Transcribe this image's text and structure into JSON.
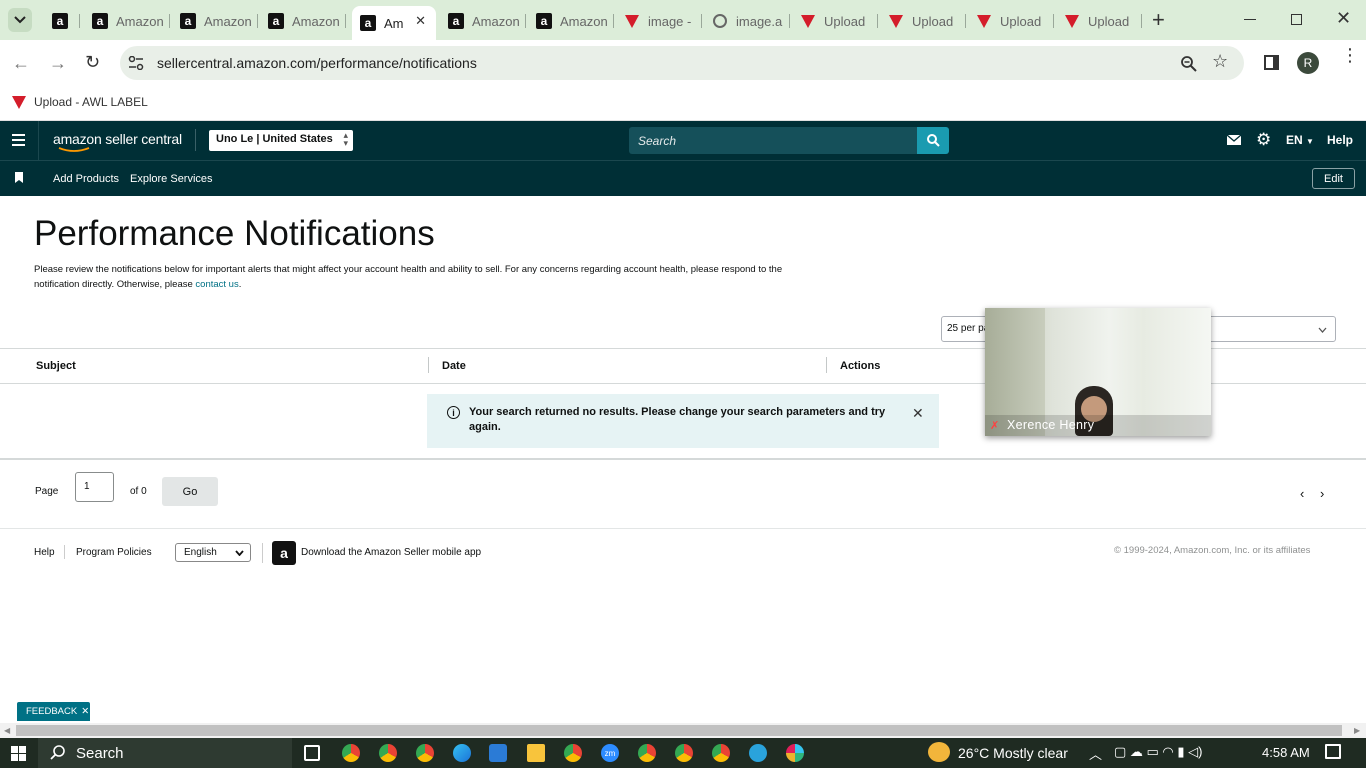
{
  "browser": {
    "tabs": [
      {
        "label": "",
        "icon": "amazon-icon"
      },
      {
        "label": "Amazon",
        "icon": "amazon-icon"
      },
      {
        "label": "Amazon",
        "icon": "amazon-icon"
      },
      {
        "label": "Amazon",
        "icon": "amazon-icon"
      },
      {
        "label": "Am",
        "icon": "amazon-icon",
        "active": true
      },
      {
        "label": "Amazon",
        "icon": "amazon-icon"
      },
      {
        "label": "Amazon",
        "icon": "amazon-icon"
      },
      {
        "label": "image -",
        "icon": "awl-icon"
      },
      {
        "label": "image.a",
        "icon": "openai-icon"
      },
      {
        "label": "Upload",
        "icon": "awl-icon"
      },
      {
        "label": "Upload",
        "icon": "awl-icon"
      },
      {
        "label": "Upload",
        "icon": "awl-icon"
      },
      {
        "label": "Upload",
        "icon": "awl-icon"
      }
    ],
    "url": "sellercentral.amazon.com/performance/notifications",
    "profile_initial": "R",
    "bookmark": "Upload - AWL LABEL"
  },
  "seller": {
    "logo": "amazon seller central",
    "account": "Uno Le | United States",
    "search_placeholder": "Search",
    "lang": "EN",
    "help": "Help",
    "nav": [
      "Add Products",
      "Explore Services"
    ],
    "edit": "Edit"
  },
  "page": {
    "title": "Performance Notifications",
    "desc": "Please review the notifications below for important alerts that might affect your account health and ability to sell. For any concerns regarding account health, please respond to the",
    "desc2": "notification directly. Otherwise, please ",
    "contact": "contact us",
    "desc_end": ".",
    "per_page": "25 per pa",
    "columns": [
      "Subject",
      "Date",
      "Actions"
    ],
    "alert": "Your search returned no results. Please change your search parameters and try",
    "alert2": "again.",
    "page_label": "Page",
    "page_value": "1",
    "of": "of 0",
    "go": "Go"
  },
  "footer": {
    "help": "Help",
    "policies": "Program Policies",
    "language": "English",
    "app": "Download the Amazon Seller mobile app",
    "copyright": "© 1999-2024, Amazon.com, Inc. or its affiliates"
  },
  "video": {
    "name": "Xerence Henry"
  },
  "feedback": "FEEDBACK",
  "taskbar": {
    "search": "Search",
    "weather": "26°C  Mostly clear",
    "time": "4:58 AM"
  },
  "colors": {
    "nav": "#002f36",
    "accent": "#007185",
    "alert_bg": "#e6f3f4"
  }
}
